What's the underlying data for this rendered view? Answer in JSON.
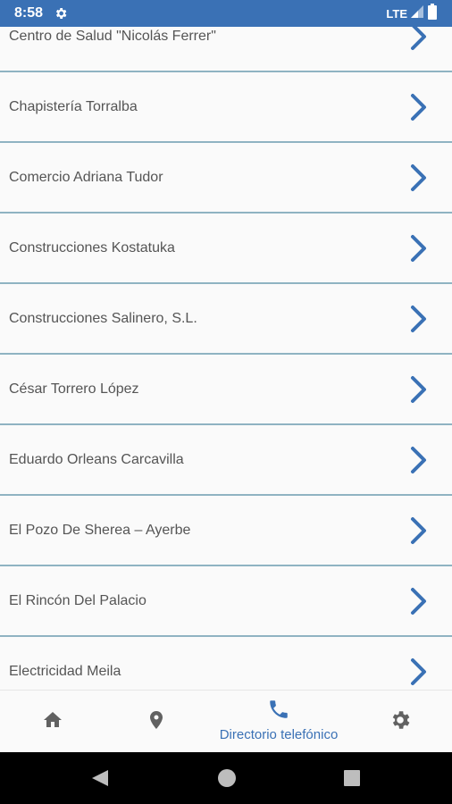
{
  "status_bar": {
    "time": "8:58",
    "network": "LTE"
  },
  "directory": {
    "items": [
      {
        "label": "Centro de Salud \"Nicolás Ferrer\""
      },
      {
        "label": "Chapistería Torralba"
      },
      {
        "label": "Comercio Adriana Tudor"
      },
      {
        "label": "Construcciones Kostatuka"
      },
      {
        "label": "Construcciones Salinero, S.L."
      },
      {
        "label": "César Torrero López"
      },
      {
        "label": "Eduardo Orleans Carcavilla"
      },
      {
        "label": "El Pozo De Sherea – Ayerbe"
      },
      {
        "label": "El Rincón Del Palacio"
      },
      {
        "label": "Electricidad Meila"
      }
    ]
  },
  "bottom_nav": {
    "items": [
      {
        "icon": "home-icon"
      },
      {
        "icon": "location-pin-icon"
      },
      {
        "icon": "phone-icon",
        "label": "Directorio telefónico",
        "active": true
      },
      {
        "icon": "gear-icon"
      }
    ]
  },
  "colors": {
    "accent": "#3a71b5",
    "divider": "#8fb3c2",
    "text": "#555555",
    "icon_inactive": "#616161"
  }
}
